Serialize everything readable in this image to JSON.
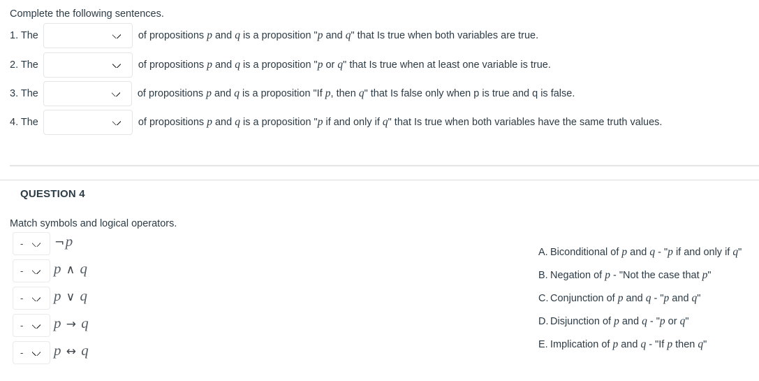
{
  "question3": {
    "prompt": "Complete the following sentences.",
    "sentences": [
      {
        "number": "1. The",
        "select_value": "",
        "tail_before_quote": "of propositions ",
        "p": "p",
        "and_word": " and ",
        "q": "q",
        "mid": " is a proposition \"",
        "quote_p": "p",
        "quote_mid": " and ",
        "quote_q": "q",
        "tail_after_quote": "\" that Is true when both variables are true."
      },
      {
        "number": "2. The",
        "select_value": "",
        "tail_before_quote": "of propositions ",
        "p": "p",
        "and_word": " and ",
        "q": "q",
        "mid": " is a proposition \"",
        "quote_p": "p",
        "quote_mid": " or ",
        "quote_q": "q",
        "tail_after_quote": "\" that Is true when at least one variable is true."
      },
      {
        "number": "3.  The",
        "select_value": "",
        "tail_before_quote": "of propositions ",
        "p": "p",
        "and_word": " and ",
        "q": "q",
        "mid": " is a proposition \"If ",
        "quote_p": "p",
        "quote_mid": ", then ",
        "quote_q": "q",
        "tail_after_quote": "\" that Is false only when p is true and q is false."
      },
      {
        "number": "4. The",
        "select_value": "",
        "tail_before_quote": "of propositions ",
        "p": "p",
        "and_word": " and ",
        "q": "q",
        "mid": " is a proposition \"",
        "quote_p": "p",
        "quote_mid": " if and only if ",
        "quote_q": "q",
        "tail_after_quote": "\" that Is true when both variables have the same truth values."
      }
    ]
  },
  "question4": {
    "heading": "QUESTION 4",
    "prompt": "Match symbols and logical operators.",
    "placeholder": "-",
    "items": [
      {
        "select_value": "-",
        "symbol_left": "¬",
        "symbol_p": "p",
        "symbol_op": "",
        "symbol_q": ""
      },
      {
        "select_value": "-",
        "symbol_left": "",
        "symbol_p": "p",
        "symbol_op": "∧",
        "symbol_q": "q"
      },
      {
        "select_value": "-",
        "symbol_left": "",
        "symbol_p": "p",
        "symbol_op": "∨",
        "symbol_q": "q"
      },
      {
        "select_value": "-",
        "symbol_left": "",
        "symbol_p": "p",
        "symbol_op": "→",
        "symbol_q": "q"
      },
      {
        "select_value": "-",
        "symbol_left": "",
        "symbol_p": "p",
        "symbol_op": "↔",
        "symbol_q": "q"
      }
    ],
    "options": [
      {
        "letter": "A.",
        "text_1": "Biconditional of ",
        "v1": "p",
        "text_2": " and ",
        "v2": "q",
        "text_3": " - \"",
        "v3": "p",
        "text_4": " if and only if ",
        "v4": "q",
        "text_5": "\""
      },
      {
        "letter": "B.",
        "text_1": "Negation of ",
        "v1": "p",
        "text_2": "",
        "v2": "",
        "text_3": " - \"Not the case that ",
        "v3": "p",
        "text_4": "",
        "v4": "",
        "text_5": "\""
      },
      {
        "letter": "C.",
        "text_1": "Conjunction of ",
        "v1": "p",
        "text_2": " and ",
        "v2": "q",
        "text_3": " - \"",
        "v3": "p",
        "text_4": " and ",
        "v4": "q",
        "text_5": "\""
      },
      {
        "letter": "D.",
        "text_1": "Disjunction of ",
        "v1": "p",
        "text_2": " and ",
        "v2": "q",
        "text_3": " - \"",
        "v3": "p",
        "text_4": " or ",
        "v4": "q",
        "text_5": "\""
      },
      {
        "letter": "E.",
        "text_1": "Implication of ",
        "v1": "p",
        "text_2": " and ",
        "v2": "q",
        "text_3": " - \"If ",
        "v3": "p",
        "text_4": " then ",
        "v4": "q",
        "text_5": "\""
      }
    ]
  },
  "theme": {
    "text_color": "#2d3b45",
    "border_color": "#e3e5e7",
    "rule_color": "#e5e5e5"
  }
}
